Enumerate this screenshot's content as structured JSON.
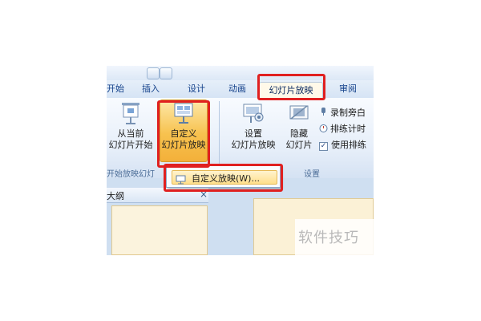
{
  "tabs": [
    "开始",
    "插入",
    "设计",
    "动画",
    "幻灯片放映",
    "审阅"
  ],
  "ribbon": {
    "from_current": [
      "从当前",
      "幻灯片开始"
    ],
    "custom_show": [
      "自定义",
      "幻灯片放映"
    ],
    "setup": [
      "设置",
      "幻灯片放映"
    ],
    "hide": [
      "隐藏",
      "幻灯片"
    ],
    "record_narration": "录制旁白",
    "rehearse_timings": "排练计时",
    "use_rehearsed": "使用排练",
    "use_rehearsed_checked": true,
    "group_start_label": "开始放映幻灯",
    "group_setup_label": "设置"
  },
  "dropdown": {
    "item_label": "自定义放映(W)..."
  },
  "left_pane": {
    "tab_label": "大纲",
    "close_symbol": "×"
  },
  "watermark": "软件技巧",
  "colors": {
    "highlight_red": "#e02020",
    "ribbon_blue": "#dfeaf7",
    "hover_orange": "#f7c24f"
  }
}
